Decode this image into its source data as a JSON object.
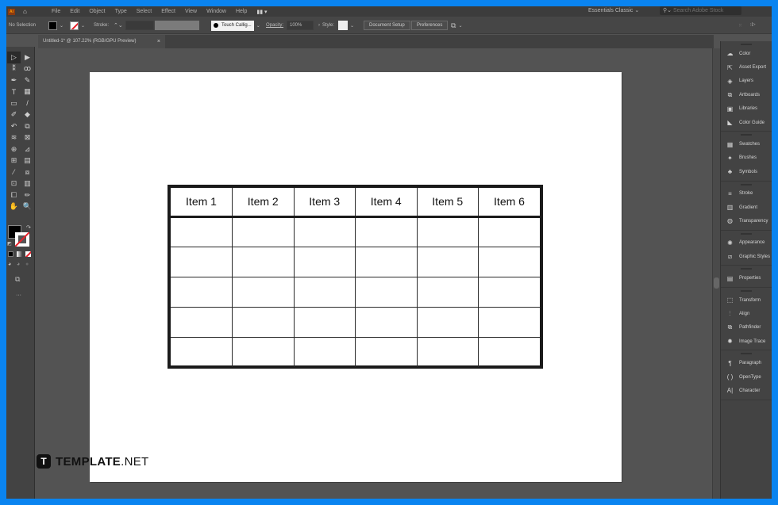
{
  "app": {
    "logo_text": "Ai",
    "menu": [
      "File",
      "Edit",
      "Object",
      "Type",
      "Select",
      "Effect",
      "View",
      "Window",
      "Help"
    ],
    "workspace": "Essentials Classic",
    "search_placeholder": "Search Adobe Stock"
  },
  "control_bar": {
    "selection_label": "No Selection",
    "stroke_label": "Stroke:",
    "brush_label": "Touch Callig...",
    "opacity_label": "Opacity:",
    "opacity_value": "100%",
    "style_label": "Style:",
    "document_setup": "Document Setup",
    "preferences": "Preferences"
  },
  "document_tab": {
    "title": "Untitled-1* @ 107.22% (RGB/GPU Preview)",
    "close": "×"
  },
  "toolbar": {
    "tools": [
      {
        "name": "selection-tool",
        "glyph": "▷"
      },
      {
        "name": "direct-selection-tool",
        "glyph": "▶"
      },
      {
        "name": "magic-wand-tool",
        "glyph": "⁑"
      },
      {
        "name": "lasso-tool",
        "glyph": "ꝏ"
      },
      {
        "name": "pen-tool",
        "glyph": "✒"
      },
      {
        "name": "curvature-tool",
        "glyph": "✎"
      },
      {
        "name": "type-tool",
        "glyph": "T"
      },
      {
        "name": "grid-tool",
        "glyph": "▦"
      },
      {
        "name": "rectangle-tool",
        "glyph": "▭"
      },
      {
        "name": "paintbrush-tool",
        "glyph": "/"
      },
      {
        "name": "shaper-tool",
        "glyph": "✐"
      },
      {
        "name": "eraser-tool",
        "glyph": "◆"
      },
      {
        "name": "rotate-tool",
        "glyph": "↶"
      },
      {
        "name": "scale-tool",
        "glyph": "⧉"
      },
      {
        "name": "warp-tool",
        "glyph": "≋"
      },
      {
        "name": "free-transform-tool",
        "glyph": "⊠"
      },
      {
        "name": "shape-builder-tool",
        "glyph": "⊕"
      },
      {
        "name": "perspective-grid-tool",
        "glyph": "⊿"
      },
      {
        "name": "mesh-tool",
        "glyph": "⊞"
      },
      {
        "name": "gradient-tool",
        "glyph": "▤"
      },
      {
        "name": "eyedropper-tool",
        "glyph": "⁄"
      },
      {
        "name": "blend-tool",
        "glyph": "⧈"
      },
      {
        "name": "symbol-sprayer-tool",
        "glyph": "⊡"
      },
      {
        "name": "column-graph-tool",
        "glyph": "▥"
      },
      {
        "name": "artboard-tool",
        "glyph": "⧠"
      },
      {
        "name": "slice-tool",
        "glyph": "✏"
      },
      {
        "name": "hand-tool",
        "glyph": "✋"
      },
      {
        "name": "zoom-tool",
        "glyph": "🔍"
      }
    ],
    "more": "···"
  },
  "table": {
    "headers": [
      "Item 1",
      "Item 2",
      "Item 3",
      "Item 4",
      "Item 5",
      "Item 6"
    ],
    "rows": [
      [
        "",
        "",
        "",
        "",
        "",
        ""
      ],
      [
        "",
        "",
        "",
        "",
        "",
        ""
      ],
      [
        "",
        "",
        "",
        "",
        "",
        ""
      ],
      [
        "",
        "",
        "",
        "",
        "",
        ""
      ],
      [
        "",
        "",
        "",
        "",
        "",
        ""
      ]
    ]
  },
  "watermark": {
    "logo": "T",
    "brand": "TEMPLATE",
    "suffix": ".NET"
  },
  "panels": [
    {
      "group": 1,
      "items": [
        {
          "label": "Color",
          "icon": "color-icon",
          "glyph": "☁"
        },
        {
          "label": "Asset Export",
          "icon": "asset-export-icon",
          "glyph": "⇱"
        },
        {
          "label": "Layers",
          "icon": "layers-icon",
          "glyph": "◈"
        },
        {
          "label": "Artboards",
          "icon": "artboards-icon",
          "glyph": "⧉"
        },
        {
          "label": "Libraries",
          "icon": "libraries-icon",
          "glyph": "▣"
        },
        {
          "label": "Color Guide",
          "icon": "color-guide-icon",
          "glyph": "◣"
        }
      ]
    },
    {
      "group": 2,
      "items": [
        {
          "label": "Swatches",
          "icon": "swatches-icon",
          "glyph": "▦"
        },
        {
          "label": "Brushes",
          "icon": "brushes-icon",
          "glyph": "✦"
        },
        {
          "label": "Symbols",
          "icon": "symbols-icon",
          "glyph": "♣"
        }
      ]
    },
    {
      "group": 3,
      "items": [
        {
          "label": "Stroke",
          "icon": "stroke-icon",
          "glyph": "≡"
        },
        {
          "label": "Gradient",
          "icon": "gradient-icon",
          "glyph": "▥"
        },
        {
          "label": "Transparency",
          "icon": "transparency-icon",
          "glyph": "◍"
        }
      ]
    },
    {
      "group": 4,
      "items": [
        {
          "label": "Appearance",
          "icon": "appearance-icon",
          "glyph": "✺"
        },
        {
          "label": "Graphic Styles",
          "icon": "graphic-styles-icon",
          "glyph": "⧄"
        }
      ]
    },
    {
      "group": 5,
      "items": [
        {
          "label": "Properties",
          "icon": "properties-icon",
          "glyph": "▤"
        }
      ]
    },
    {
      "group": 6,
      "items": [
        {
          "label": "Transform",
          "icon": "transform-icon",
          "glyph": "⬚"
        },
        {
          "label": "Align",
          "icon": "align-icon",
          "glyph": "⫶"
        },
        {
          "label": "Pathfinder",
          "icon": "pathfinder-icon",
          "glyph": "⧉"
        },
        {
          "label": "Image Trace",
          "icon": "image-trace-icon",
          "glyph": "✹"
        }
      ]
    },
    {
      "group": 7,
      "items": [
        {
          "label": "Paragraph",
          "icon": "paragraph-icon",
          "glyph": "¶"
        },
        {
          "label": "OpenType",
          "icon": "opentype-icon",
          "glyph": "( )"
        },
        {
          "label": "Character",
          "icon": "character-icon",
          "glyph": "A|"
        }
      ]
    }
  ]
}
